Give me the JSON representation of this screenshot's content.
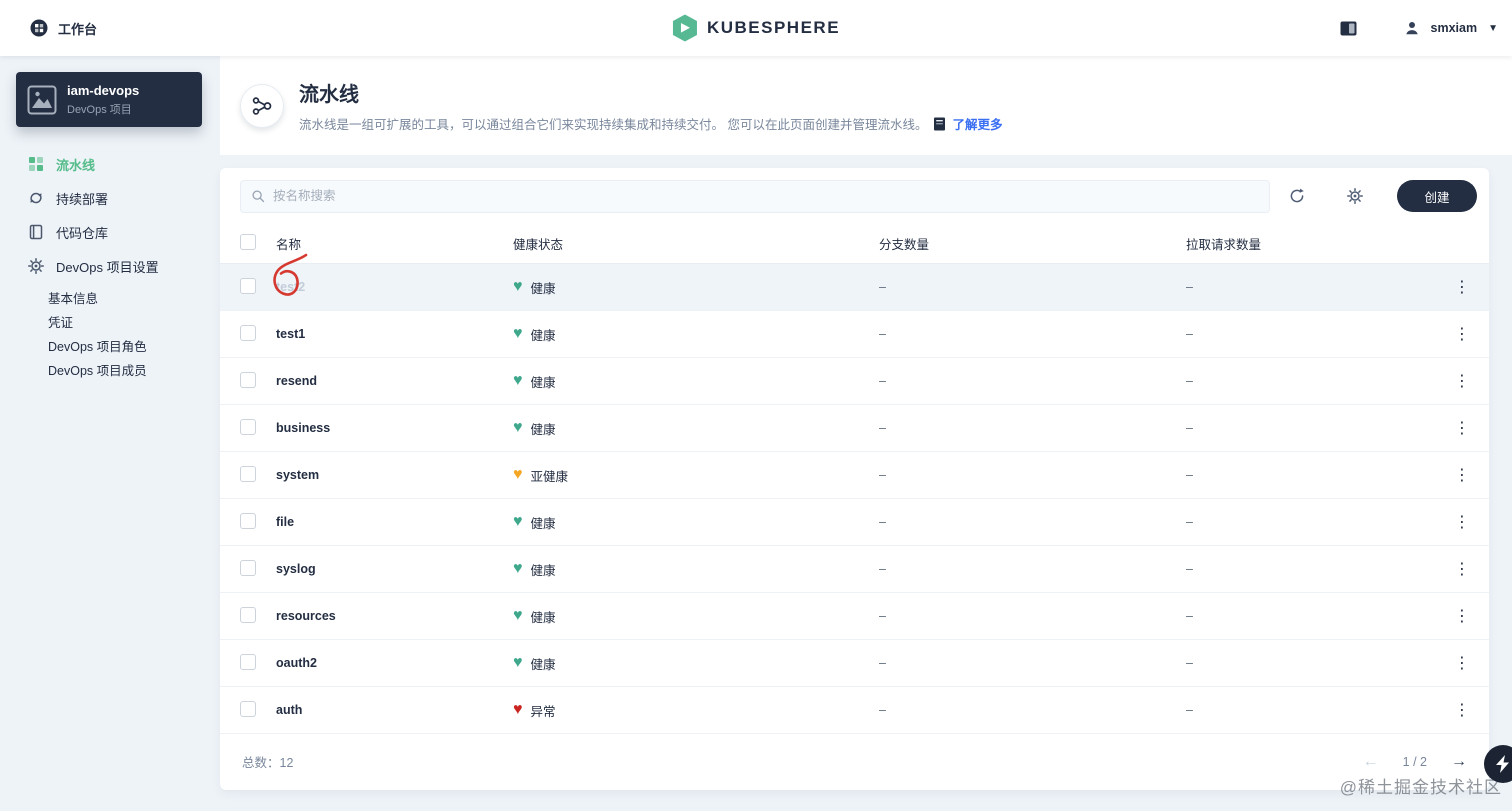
{
  "topbar": {
    "workbench_label": "工作台",
    "brand": "KUBESPHERE",
    "username": "smxiam"
  },
  "sidebar": {
    "project_name": "iam-devops",
    "project_type": "DevOps 项目",
    "nav": [
      {
        "label": "流水线"
      },
      {
        "label": "持续部署"
      },
      {
        "label": "代码仓库"
      },
      {
        "label": "DevOps 项目设置"
      }
    ],
    "sub_nav": [
      {
        "label": "基本信息"
      },
      {
        "label": "凭证"
      },
      {
        "label": "DevOps 项目角色"
      },
      {
        "label": "DevOps 项目成员"
      }
    ]
  },
  "page_header": {
    "title": "流水线",
    "description": "流水线是一组可扩展的工具，可以通过组合它们来实现持续集成和持续交付。 您可以在此页面创建并管理流水线。",
    "learn_more": "了解更多"
  },
  "toolbar": {
    "search_placeholder": "按名称搜索",
    "create_label": "创建"
  },
  "table": {
    "headers": {
      "name": "名称",
      "health": "健康状态",
      "branches": "分支数量",
      "pull_requests": "拉取请求数量"
    },
    "rows": [
      {
        "name": "test2",
        "health": "健康",
        "status": "healthy",
        "branches": "–",
        "pull_requests": "–"
      },
      {
        "name": "test1",
        "health": "健康",
        "status": "healthy",
        "branches": "–",
        "pull_requests": "–"
      },
      {
        "name": "resend",
        "health": "健康",
        "status": "healthy",
        "branches": "–",
        "pull_requests": "–"
      },
      {
        "name": "business",
        "health": "健康",
        "status": "healthy",
        "branches": "–",
        "pull_requests": "–"
      },
      {
        "name": "system",
        "health": "亚健康",
        "status": "warning",
        "branches": "–",
        "pull_requests": "–"
      },
      {
        "name": "file",
        "health": "健康",
        "status": "healthy",
        "branches": "–",
        "pull_requests": "–"
      },
      {
        "name": "syslog",
        "health": "健康",
        "status": "healthy",
        "branches": "–",
        "pull_requests": "–"
      },
      {
        "name": "resources",
        "health": "健康",
        "status": "healthy",
        "branches": "–",
        "pull_requests": "–"
      },
      {
        "name": "oauth2",
        "health": "健康",
        "status": "healthy",
        "branches": "–",
        "pull_requests": "–"
      },
      {
        "name": "auth",
        "health": "异常",
        "status": "error",
        "branches": "–",
        "pull_requests": "–"
      }
    ]
  },
  "footer": {
    "total_label": "总数：",
    "total_value": "12",
    "page_indicator": "1 / 2"
  },
  "watermark": "@稀土掘金技术社区",
  "colors": {
    "accent_green": "#55bc8a",
    "healthy": "#3fa88c",
    "warning": "#f5a623",
    "error": "#ca2621",
    "dark": "#242e42"
  }
}
